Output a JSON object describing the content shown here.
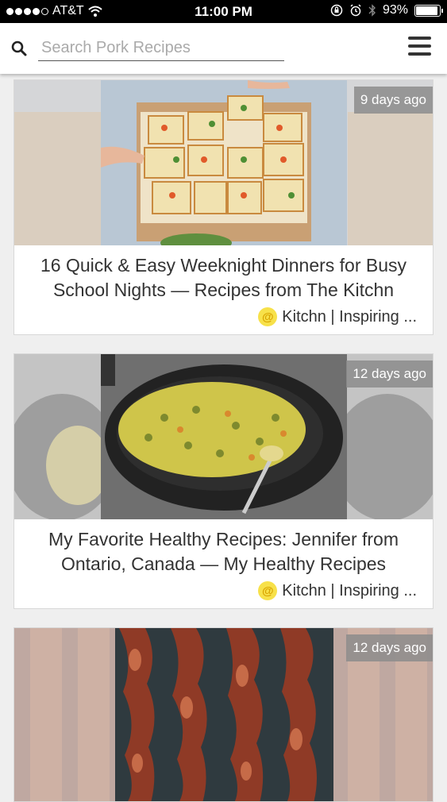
{
  "status_bar": {
    "carrier": "AT&T",
    "time": "11:00 PM",
    "battery": "93%"
  },
  "search": {
    "placeholder": "Search Pork Recipes"
  },
  "cards": [
    {
      "badge": "9 days ago",
      "title": "16 Quick & Easy Weeknight Dinners for Busy School Nights — Recipes from The Kitchn",
      "source": "Kitchn | Inspiring ..."
    },
    {
      "badge": "12 days ago",
      "title": "My Favorite Healthy Recipes: Jennifer from Ontario, Canada — My Healthy Recipes",
      "source": "Kitchn | Inspiring ..."
    },
    {
      "badge": "12 days ago"
    }
  ],
  "icons": {
    "search": "search-icon",
    "menu": "hamburger-menu-icon",
    "wifi": "wifi-icon",
    "bluetooth": "bluetooth-icon",
    "alarm": "alarm-icon",
    "orientation_lock": "orientation-lock-icon",
    "source_logo": "kitchn-logo-icon"
  },
  "colors": {
    "status_bar": "#000000",
    "badge": "#8c8c8c",
    "source_logo": "#f7e14a"
  }
}
